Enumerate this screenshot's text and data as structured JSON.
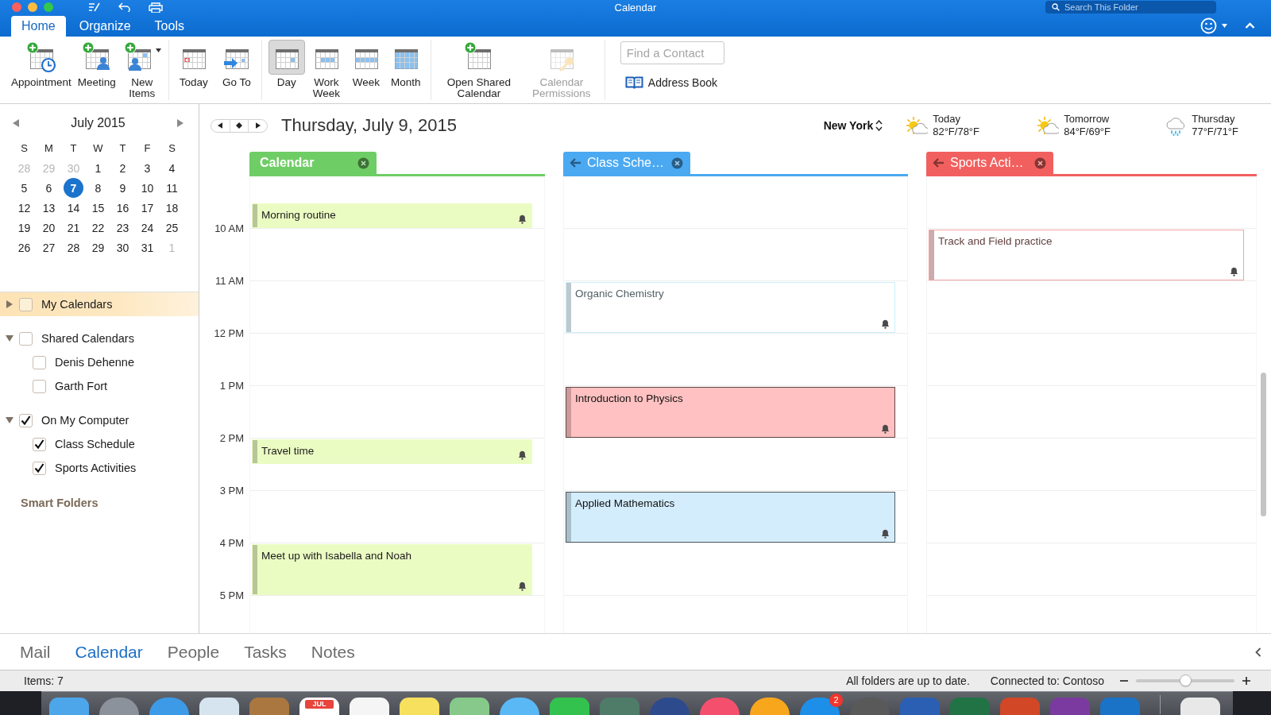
{
  "window": {
    "title": "Calendar",
    "search": {
      "placeholder": "Search This Folder"
    }
  },
  "tabs": [
    {
      "label": "Home",
      "selected": true
    },
    {
      "label": "Organize",
      "selected": false
    },
    {
      "label": "Tools",
      "selected": false
    }
  ],
  "ribbon": {
    "groups": [
      {
        "items": [
          {
            "label": "Appointment",
            "kind": "appointment"
          },
          {
            "label": "Meeting",
            "kind": "meeting"
          },
          {
            "label": "New Items",
            "kind": "new"
          }
        ]
      },
      {
        "items": [
          {
            "label": "Today",
            "kind": "today"
          },
          {
            "label": "Go To",
            "kind": "goto"
          }
        ]
      },
      {
        "items": [
          {
            "label": "Day",
            "kind": "day",
            "selected": true
          },
          {
            "label": "Work Week",
            "kind": "workweek",
            "selected": false
          },
          {
            "label": "Week",
            "kind": "week",
            "selected": false
          },
          {
            "label": "Month",
            "kind": "month",
            "selected": false
          }
        ]
      },
      {
        "items": [
          {
            "label": "Open Shared Calendar",
            "kind": "share",
            "disabled": false
          },
          {
            "label": "Calendar Permissions",
            "kind": "permissions",
            "disabled": true
          }
        ]
      }
    ],
    "contact_search": {
      "placeholder": "Find a Contact"
    },
    "address_book": {
      "label": "Address Book"
    }
  },
  "mini_calendar": {
    "title": "July 2015",
    "weekdays": [
      "S",
      "M",
      "T",
      "W",
      "T",
      "F",
      "S"
    ],
    "weeks": [
      [
        {
          "day": "28",
          "muted": true,
          "selected": false
        },
        {
          "day": "29",
          "muted": true,
          "selected": false
        },
        {
          "day": "30",
          "muted": true,
          "selected": false
        },
        {
          "day": "1",
          "muted": false,
          "selected": false
        },
        {
          "day": "2",
          "muted": false,
          "selected": false
        },
        {
          "day": "3",
          "muted": false,
          "selected": false
        },
        {
          "day": "4",
          "muted": false,
          "selected": false
        }
      ],
      [
        {
          "day": "5",
          "muted": false,
          "selected": false
        },
        {
          "day": "6",
          "muted": false,
          "selected": false
        },
        {
          "day": "7",
          "muted": false,
          "selected": true
        },
        {
          "day": "8",
          "muted": false,
          "selected": false
        },
        {
          "day": "9",
          "muted": false,
          "selected": false
        },
        {
          "day": "10",
          "muted": false,
          "selected": false
        },
        {
          "day": "11",
          "muted": false,
          "selected": false
        }
      ],
      [
        {
          "day": "12",
          "muted": false,
          "selected": false
        },
        {
          "day": "13",
          "muted": false,
          "selected": false
        },
        {
          "day": "14",
          "muted": false,
          "selected": false
        },
        {
          "day": "15",
          "muted": false,
          "selected": false
        },
        {
          "day": "16",
          "muted": false,
          "selected": false
        },
        {
          "day": "17",
          "muted": false,
          "selected": false
        },
        {
          "day": "18",
          "muted": false,
          "selected": false
        }
      ],
      [
        {
          "day": "19",
          "muted": false,
          "selected": false
        },
        {
          "day": "20",
          "muted": false,
          "selected": false
        },
        {
          "day": "21",
          "muted": false,
          "selected": false
        },
        {
          "day": "22",
          "muted": false,
          "selected": false
        },
        {
          "day": "23",
          "muted": false,
          "selected": false
        },
        {
          "day": "24",
          "muted": false,
          "selected": false
        },
        {
          "day": "25",
          "muted": false,
          "selected": false
        }
      ],
      [
        {
          "day": "26",
          "muted": false,
          "selected": false
        },
        {
          "day": "27",
          "muted": false,
          "selected": false
        },
        {
          "day": "28",
          "muted": false,
          "selected": false
        },
        {
          "day": "29",
          "muted": false,
          "selected": false
        },
        {
          "day": "30",
          "muted": false,
          "selected": false
        },
        {
          "day": "31",
          "muted": false,
          "selected": false
        },
        {
          "day": "1",
          "muted": true,
          "selected": false
        }
      ]
    ]
  },
  "folders": {
    "items": [
      {
        "label": "My Calendars",
        "expanded": false,
        "checked": false,
        "selected": true
      },
      {
        "label": "Shared Calendars",
        "expanded": true,
        "checked": false,
        "selected": false,
        "children": [
          {
            "label": "Denis Dehenne",
            "checked": false,
            "selected": false
          },
          {
            "label": "Garth Fort",
            "checked": false,
            "selected": false
          }
        ]
      },
      {
        "label": "On My Computer",
        "expanded": true,
        "checked": true,
        "selected": false,
        "children": [
          {
            "label": "Class Schedule",
            "checked": true,
            "selected": false
          },
          {
            "label": "Sports Activities",
            "checked": true,
            "selected": false
          }
        ]
      }
    ],
    "smart_folders": "Smart Folders"
  },
  "day_view": {
    "title": "Thursday, July 9, 2015",
    "location": "New York",
    "weather": [
      {
        "day": "Today",
        "temperatures": "82°F/78°F",
        "kind": "partlysunny"
      },
      {
        "day": "Tomorrow",
        "temperatures": "84°F/69°F",
        "kind": "partlysunny"
      },
      {
        "day": "Thursday",
        "temperatures": "77°F/71°F",
        "kind": "rain"
      }
    ],
    "hours": [
      "10 AM",
      "11 AM",
      "12 PM",
      "1 PM",
      "2 PM",
      "3 PM",
      "4 PM",
      "5 PM"
    ],
    "calendars": [
      {
        "label": "Calendar",
        "color": "#6fcd66",
        "selected": true,
        "back_arrow": false,
        "events": [
          {
            "title": "Morning routine",
            "kind": "filled",
            "color": "#ebfcc3",
            "reminder": true
          },
          {
            "title": "Travel time",
            "kind": "filled",
            "color": "#ebfcc3",
            "reminder": true
          },
          {
            "title": "Meet up with Isabella and Noah",
            "kind": "filled",
            "color": "#ebfcc3",
            "reminder": true
          }
        ]
      },
      {
        "label": "Class Sche…",
        "color": "#4ba9f2",
        "selected": false,
        "back_arrow": true,
        "events": [
          {
            "title": "Organic Chemistry",
            "kind": "outlined",
            "color": "#cdeffc",
            "reminder": true
          },
          {
            "title": "Introduction to Physics",
            "kind": "framed",
            "color": "#ffc1c1",
            "reminder": true
          },
          {
            "title": "Applied Mathematics",
            "kind": "framed",
            "color": "#d4edfd",
            "reminder": true
          }
        ]
      },
      {
        "label": "Sports Acti…",
        "color": "#f1605f",
        "selected": false,
        "back_arrow": true,
        "events": [
          {
            "title": "Track and Field practice",
            "kind": "outlined",
            "color": "#f4a3a3",
            "reminder": true
          }
        ]
      }
    ]
  },
  "nav": {
    "items": [
      {
        "label": "Mail",
        "selected": false
      },
      {
        "label": "Calendar",
        "selected": true
      },
      {
        "label": "People",
        "selected": false
      },
      {
        "label": "Tasks",
        "selected": false
      },
      {
        "label": "Notes",
        "selected": false
      }
    ]
  },
  "status_bar": {
    "items": "Items: 7",
    "sync": "All folders are up to date.",
    "connection": "Connected to: Contoso",
    "zoom": {
      "level": 0.5
    }
  },
  "dock": {
    "items": [
      {
        "kind": "square",
        "color": "#4da6ea"
      },
      {
        "kind": "round",
        "color": "#8c929c"
      },
      {
        "kind": "round",
        "color": "#3d9ae6"
      },
      {
        "kind": "square",
        "color": "#d6e4f0"
      },
      {
        "kind": "square",
        "color": "#a9773f"
      },
      {
        "kind": "square",
        "color": "#ffffff",
        "text": "JUL"
      },
      {
        "kind": "square",
        "color": "#f5f5f5"
      },
      {
        "kind": "square",
        "color": "#f6e05e"
      },
      {
        "kind": "square",
        "color": "#86c98a"
      },
      {
        "kind": "round",
        "color": "#5ab8f4"
      },
      {
        "kind": "square",
        "color": "#33c24d"
      },
      {
        "kind": "square",
        "color": "#4e7c68"
      },
      {
        "kind": "round",
        "color": "#2d4b8c"
      },
      {
        "kind": "round",
        "color": "#f4506d"
      },
      {
        "kind": "round",
        "color": "#f8a61c"
      },
      {
        "kind": "round",
        "color": "#1e8fe8",
        "badge": "2"
      },
      {
        "kind": "round",
        "color": "#595959"
      },
      {
        "kind": "square",
        "color": "#2b5fb4"
      },
      {
        "kind": "square",
        "color": "#217346"
      },
      {
        "kind": "square",
        "color": "#d24726"
      },
      {
        "kind": "square",
        "color": "#7b3a9f"
      },
      {
        "kind": "square",
        "color": "#1a73c7"
      }
    ],
    "trailing_items": [
      {
        "kind": "square",
        "color": "#e8e8e8"
      }
    ]
  }
}
